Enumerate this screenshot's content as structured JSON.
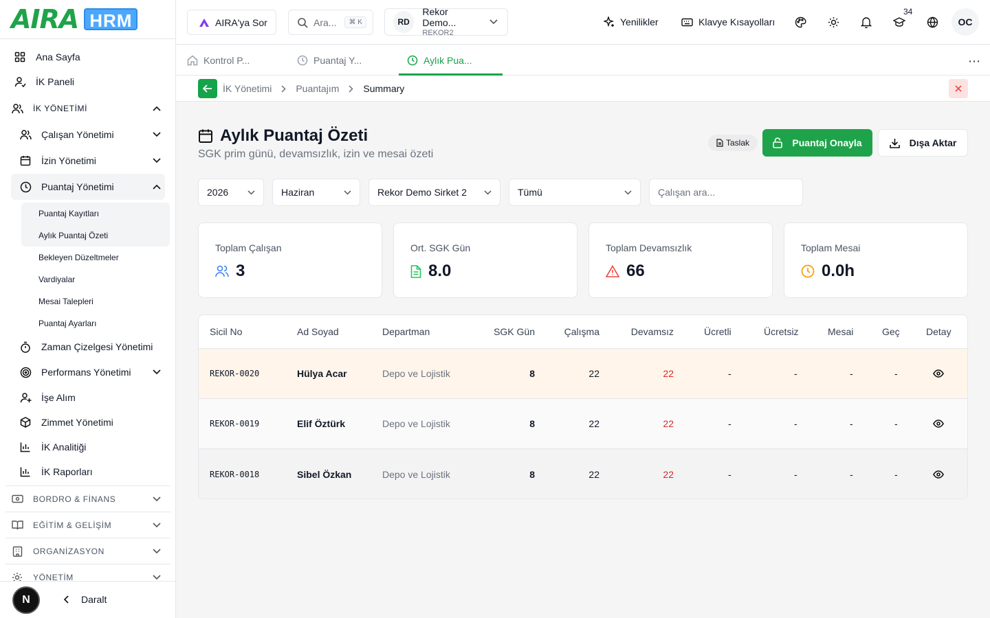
{
  "brand": {
    "logo_text": "AIRA",
    "logo_badge": "HRM",
    "accent": "#1fa34a"
  },
  "sidebar": {
    "home": "Ana Sayfa",
    "hr_panel": "İK Paneli",
    "section_hr": "İK YÖNETİMİ",
    "employee_mgmt": "Çalışan Yönetimi",
    "leave_mgmt": "İzin Yönetimi",
    "timesheet_mgmt": "Puantaj Yönetimi",
    "timesheet_sub": [
      "Puantaj Kayıtları",
      "Aylık Puantaj Özeti",
      "Bekleyen Düzeltmeler",
      "Vardiyalar",
      "Mesai Talepleri",
      "Puantaj Ayarları"
    ],
    "schedule_mgmt": "Zaman Çizelgesi Yönetimi",
    "performance_mgmt": "Performans Yönetimi",
    "recruitment": "İşe Alım",
    "assets": "Zimmet Yönetimi",
    "analytics": "İK Analitiği",
    "reports": "İK Raporları",
    "section_payroll": "BORDRO & FİNANS",
    "section_training": "EĞİTİM & GELİŞİM",
    "section_org": "ORGANİZASYON",
    "section_admin": "YÖNETİM",
    "collapse": "Daralt",
    "n_badge": "N"
  },
  "topbar": {
    "ask_aira": "AIRA'ya Sor",
    "search_placeholder": "Ara...",
    "search_kbd": "⌘ K",
    "company_initials": "RD",
    "company_name": "Rekor Demo...",
    "company_code": "REKOR2",
    "whats_new": "Yenilikler",
    "shortcuts": "Klavye Kısayolları",
    "notif_count": "34",
    "avatar": "OC"
  },
  "tabs": [
    {
      "label": "Kontrol P...",
      "active": false
    },
    {
      "label": "Puantaj Y...",
      "active": false
    },
    {
      "label": "Aylık Pua...",
      "active": true
    }
  ],
  "breadcrumb": [
    "İK Yönetimi",
    "Puantajım",
    "Summary"
  ],
  "page": {
    "title": "Aylık Puantaj Özeti",
    "subtitle": "SGK prim günü, devamsızlık, izin ve mesai özeti",
    "status": "Taslak",
    "approve": "Puantaj Onayla",
    "export": "Dışa Aktar"
  },
  "filters": {
    "year": "2026",
    "month": "Haziran",
    "company": "Rekor Demo Sirket 2",
    "scope": "Tümü",
    "employee_placeholder": "Çalışan ara..."
  },
  "stats": [
    {
      "label": "Toplam Çalışan",
      "value": "3",
      "icon": "users-icon",
      "color": "#3b82f6"
    },
    {
      "label": "Ort. SGK Gün",
      "value": "8.0",
      "icon": "document-icon",
      "color": "#22c55e"
    },
    {
      "label": "Toplam Devamsızlık",
      "value": "66",
      "icon": "warning-icon",
      "color": "#ef4444"
    },
    {
      "label": "Toplam Mesai",
      "value": "0.0h",
      "icon": "clock-icon",
      "color": "#f59e0b"
    }
  ],
  "table": {
    "headers": [
      "Sicil No",
      "Ad Soyad",
      "Departman",
      "SGK Gün",
      "Çalışma",
      "Devamsız",
      "Ücretli",
      "Ücretsiz",
      "Mesai",
      "Geç",
      "Detay"
    ],
    "rows": [
      [
        "REKOR-0020",
        "Hülya Acar",
        "Depo ve Lojistik",
        "8",
        "22",
        "22",
        "-",
        "-",
        "-",
        "-"
      ],
      [
        "REKOR-0019",
        "Elif Öztürk",
        "Depo ve Lojistik",
        "8",
        "22",
        "22",
        "-",
        "-",
        "-",
        "-"
      ],
      [
        "REKOR-0018",
        "Sibel Özkan",
        "Depo ve Lojistik",
        "8",
        "22",
        "22",
        "-",
        "-",
        "-",
        "-"
      ]
    ]
  }
}
